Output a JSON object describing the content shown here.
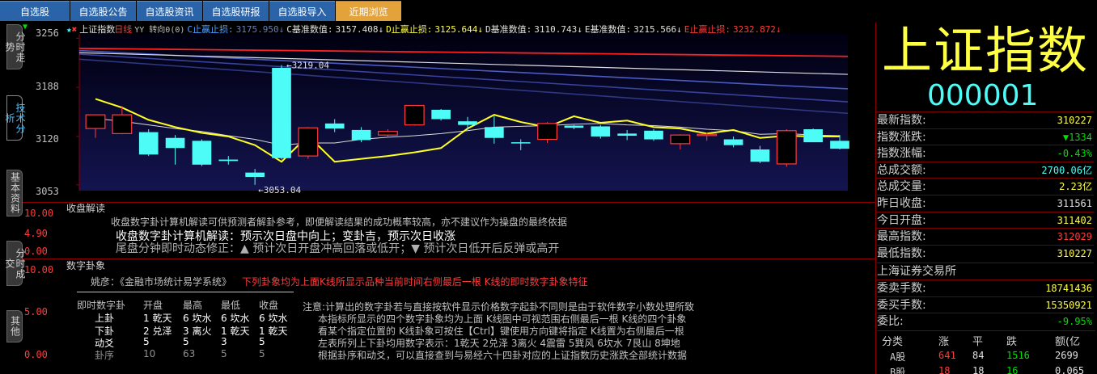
{
  "nav": {
    "tabs": [
      "自选股",
      "自选股公告",
      "自选股资讯",
      "自选股研报",
      "自选股导入",
      "近期浏览"
    ]
  },
  "side_tabs": [
    "分时走势",
    "技术分析",
    "基本资料",
    "分时成交",
    "其他"
  ],
  "legend": {
    "title": "上证指数",
    "period": "日线",
    "extra": "YY 转向0(0)",
    "c_label": "C止赢止损:",
    "c_val": "3175.950↓",
    "cb_label": "C基准数值:",
    "cb_val": "3157.408↓",
    "d_label": "D止赢止损:",
    "d_val": "3125.644↓",
    "db_label": "D基准数值:",
    "db_val": "3110.743↓",
    "eb_label": "E基准数值:",
    "eb_val": "3215.566↓",
    "e_label": "E止赢止损:",
    "e_val": "3232.872↓"
  },
  "chart_data": {
    "type": "candlestick",
    "y_ticks": [
      "3256",
      "3188",
      "3120",
      "3053"
    ],
    "ylim": [
      3045,
      3262
    ],
    "annotations": [
      {
        "text": "←3219.04",
        "value": 3219.04
      },
      {
        "text": "←3053.04",
        "value": 3053.04
      }
    ],
    "candles": [
      {
        "o": 3131,
        "h": 3150,
        "l": 3118,
        "c": 3150
      },
      {
        "o": 3124,
        "h": 3162,
        "l": 3123,
        "c": 3150
      },
      {
        "o": 3126,
        "h": 3130,
        "l": 3093,
        "c": 3095
      },
      {
        "o": 3118,
        "h": 3122,
        "l": 3081,
        "c": 3104
      },
      {
        "o": 3114,
        "h": 3116,
        "l": 3079,
        "c": 3081
      },
      {
        "o": 3088,
        "h": 3093,
        "l": 3081,
        "c": 3086
      },
      {
        "o": 3070,
        "h": 3075,
        "l": 3053,
        "c": 3064
      },
      {
        "o": 3215,
        "h": 3219,
        "l": 3088,
        "c": 3090
      },
      {
        "o": 3093,
        "h": 3133,
        "l": 3089,
        "c": 3132
      },
      {
        "o": 3138,
        "h": 3144,
        "l": 3126,
        "c": 3131
      },
      {
        "o": 3129,
        "h": 3133,
        "l": 3112,
        "c": 3115
      },
      {
        "o": 3122,
        "h": 3130,
        "l": 3118,
        "c": 3127
      },
      {
        "o": 3136,
        "h": 3163,
        "l": 3135,
        "c": 3163
      },
      {
        "o": 3157,
        "h": 3158,
        "l": 3142,
        "c": 3144
      },
      {
        "o": 3141,
        "h": 3147,
        "l": 3129,
        "c": 3136
      },
      {
        "o": 3133,
        "h": 3148,
        "l": 3110,
        "c": 3118
      },
      {
        "o": 3112,
        "h": 3116,
        "l": 3101,
        "c": 3111
      },
      {
        "o": 3116,
        "h": 3140,
        "l": 3111,
        "c": 3138
      },
      {
        "o": 3135,
        "h": 3136,
        "l": 3130,
        "c": 3132
      },
      {
        "o": 3134,
        "h": 3136,
        "l": 3117,
        "c": 3120
      },
      {
        "o": 3124,
        "h": 3129,
        "l": 3115,
        "c": 3121
      },
      {
        "o": 3128,
        "h": 3130,
        "l": 3114,
        "c": 3116
      },
      {
        "o": 3110,
        "h": 3123,
        "l": 3102,
        "c": 3122
      },
      {
        "o": 3122,
        "h": 3125,
        "l": 3114,
        "c": 3123
      },
      {
        "o": 3116,
        "h": 3120,
        "l": 3105,
        "c": 3108
      },
      {
        "o": 3102,
        "h": 3107,
        "l": 3083,
        "c": 3085
      },
      {
        "o": 3082,
        "h": 3130,
        "l": 3078,
        "c": 3128
      },
      {
        "o": 3130,
        "h": 3131,
        "l": 3112,
        "c": 3112
      },
      {
        "o": 3114,
        "h": 3122,
        "l": 3102,
        "c": 3103
      }
    ],
    "yellow": [
      3172,
      3160,
      3143,
      3133,
      3125,
      3120,
      3108,
      3085,
      3121,
      3085,
      3089,
      3093,
      3098,
      3104,
      3131,
      3150,
      3140,
      3133,
      3148,
      3139,
      3142,
      3133,
      3131,
      3124,
      3129,
      3118,
      3121,
      3120,
      3120
    ],
    "white": [
      3145,
      3141,
      3136,
      3131,
      3127,
      3121,
      3116,
      3108,
      3111,
      3111,
      3116,
      3119,
      3121,
      3124,
      3128,
      3133,
      3134,
      3135,
      3137,
      3138,
      3136,
      3135,
      3133,
      3130,
      3128,
      3123,
      3124,
      3122,
      3121
    ],
    "red_line": [
      3242,
      3231
    ],
    "white_line": [
      3236,
      3206
    ],
    "blue_lines": [
      [
        3239,
        3186
      ],
      [
        3234,
        3168
      ],
      [
        3227,
        3152
      ]
    ]
  },
  "panel1": {
    "title": "收盘解读",
    "yticks": [
      "10.00",
      "4.90",
      "0.00"
    ],
    "line1": "收盘数字卦计算机解读可供预测者解卦参考，即便解读结果的成功概率较高，亦不建议作为操盘的最终依据",
    "line2": "收盘数字卦计算机解读：预示次日盘中向上；变卦吉，预示次日收涨",
    "line3": "尾盘分钟即时动态修正：▲ 预计次日开盘冲高回落或低开；▼ 预计次日低开后反弹或高开"
  },
  "panel2": {
    "title": "数字卦象",
    "yticks": [
      "10.00",
      "5.00",
      "0.00"
    ],
    "subtitle_a": "姚彦：《金融市场统计易学系统》",
    "subtitle_b": "下列卦象均为上面K线所显示品种当前时间右侧最后一根 K线的即时数字卦象特征",
    "headers": [
      "即时数字卦",
      "开盘",
      "最高",
      "最低",
      "收盘"
    ],
    "rows": [
      [
        "上卦",
        "1 乾天",
        "6 坎水",
        "6 坎水",
        "6 坎水"
      ],
      [
        "下卦",
        "2 兑泽",
        "3 离火",
        "1 乾天",
        "1 乾天"
      ],
      [
        "动爻",
        "5",
        "5",
        "3",
        "5"
      ],
      [
        "卦序",
        "10",
        "63",
        "5",
        "5"
      ]
    ],
    "notes": [
      "注意:计算出的数字卦若与直接按软件显示价格数字起卦不同则是由于软件数字小数处理所致",
      "本指标所显示的四个数字卦象均为上面 K线图中可视范围右侧最后一根 K线的四个卦象",
      "看某个指定位置的 K线卦象可按住【Ctrl】键使用方向键将指定 K线置为右侧最后一根",
      "左表所列上下卦均用数字表示：1乾天 2兑泽 3离火 4震雷 5巽风 6坎水 7艮山 8坤地",
      "根据卦序和动爻，可以直接查到与易经六十四卦对应的上证指数历史涨跌全部统计数据"
    ]
  },
  "right": {
    "name": "上证指数",
    "code": "000001",
    "rows": [
      {
        "k": "最新指数:",
        "v": "310227",
        "c": "#ffff44"
      },
      {
        "k": "指数涨跌:",
        "v": "▼1334",
        "c": "#00e000"
      },
      {
        "k": "指数涨幅:",
        "v": "-0.43%",
        "c": "#00e000"
      },
      {
        "k": "总成交额:",
        "v": "2700.06亿",
        "c": "#4dfcf7"
      },
      {
        "k": "总成交量:",
        "v": "2.23亿",
        "c": "#ffff44"
      },
      {
        "k": "昨日收盘:",
        "v": "311561",
        "c": "#e0e0e0"
      },
      {
        "k": "今日开盘:",
        "v": "311402",
        "c": "#ffff44"
      },
      {
        "k": "最高指数:",
        "v": "312029",
        "c": "#ff3b3b"
      },
      {
        "k": "最低指数:",
        "v": "310227",
        "c": "#ffff44"
      }
    ],
    "exchange": "上海证券交易所",
    "rows2": [
      {
        "k": "委卖手数:",
        "v": "18741436",
        "c": "#ffff44"
      },
      {
        "k": "委买手数:",
        "v": "15350921",
        "c": "#ffff44"
      },
      {
        "k": "委比:",
        "v": "-9.95%",
        "c": "#00e000"
      }
    ],
    "table_headers": [
      "分类",
      "涨",
      "平",
      "跌",
      "额(亿"
    ],
    "table_rows": [
      [
        "A股",
        "641",
        "84",
        "1516",
        "2699"
      ],
      [
        "B股",
        "18",
        "18",
        "16",
        "0.065"
      ]
    ]
  },
  "colors": {
    "up": "#ff3b3b",
    "down": "#4dfcf7",
    "yellow": "#ffff44",
    "navy": "#0b0b3c"
  }
}
